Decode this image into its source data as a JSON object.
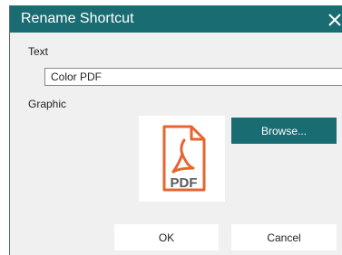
{
  "window": {
    "title": "Rename Shortcut",
    "accent_color": "#1a6c73"
  },
  "form": {
    "text_label": "Text",
    "text_value": "Color PDF",
    "graphic_label": "Graphic"
  },
  "graphic": {
    "icon": "pdf-file-icon",
    "icon_color": "#e8642e",
    "icon_text": "PDF"
  },
  "buttons": {
    "browse_label": "Browse...",
    "ok_label": "OK",
    "cancel_label": "Cancel"
  }
}
